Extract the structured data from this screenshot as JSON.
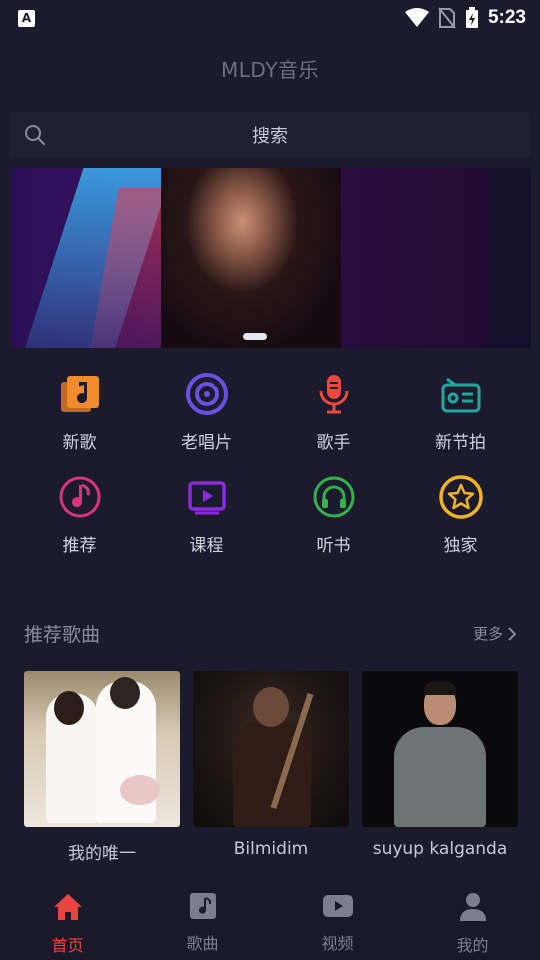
{
  "status_bar": {
    "notification_icon": "A",
    "time": "5:23"
  },
  "header": {
    "app_title": "MLDY音乐"
  },
  "search": {
    "label": "搜索"
  },
  "categories": [
    {
      "label": "新歌",
      "icon": "music-note-square-icon",
      "color": "#f08c2e"
    },
    {
      "label": "老唱片",
      "icon": "vinyl-disc-icon",
      "color": "#6b4fe0"
    },
    {
      "label": "歌手",
      "icon": "microphone-icon",
      "color": "#e84a3f"
    },
    {
      "label": "新节拍",
      "icon": "radio-icon",
      "color": "#1fa7a0"
    },
    {
      "label": "推荐",
      "icon": "music-note-circle-icon",
      "color": "#d8337e"
    },
    {
      "label": "课程",
      "icon": "video-play-icon",
      "color": "#8a2be2"
    },
    {
      "label": "听书",
      "icon": "headphones-icon",
      "color": "#34b14b"
    },
    {
      "label": "独家",
      "icon": "star-circle-icon",
      "color": "#f0b51e"
    }
  ],
  "recommended": {
    "title": "推荐歌曲",
    "more_label": "更多",
    "songs": [
      {
        "title": "我的唯一"
      },
      {
        "title": "Bilmidim"
      },
      {
        "title": "suyup kalganda"
      }
    ]
  },
  "tab_bar": {
    "tabs": [
      {
        "label": "首页",
        "icon": "home-icon",
        "active": true
      },
      {
        "label": "歌曲",
        "icon": "music-note-icon",
        "active": false
      },
      {
        "label": "视频",
        "icon": "youtube-play-icon",
        "active": false
      },
      {
        "label": "我的",
        "icon": "user-icon",
        "active": false
      }
    ]
  },
  "colors": {
    "background": "#1c1b2e",
    "accent_active": "#e8463e"
  }
}
